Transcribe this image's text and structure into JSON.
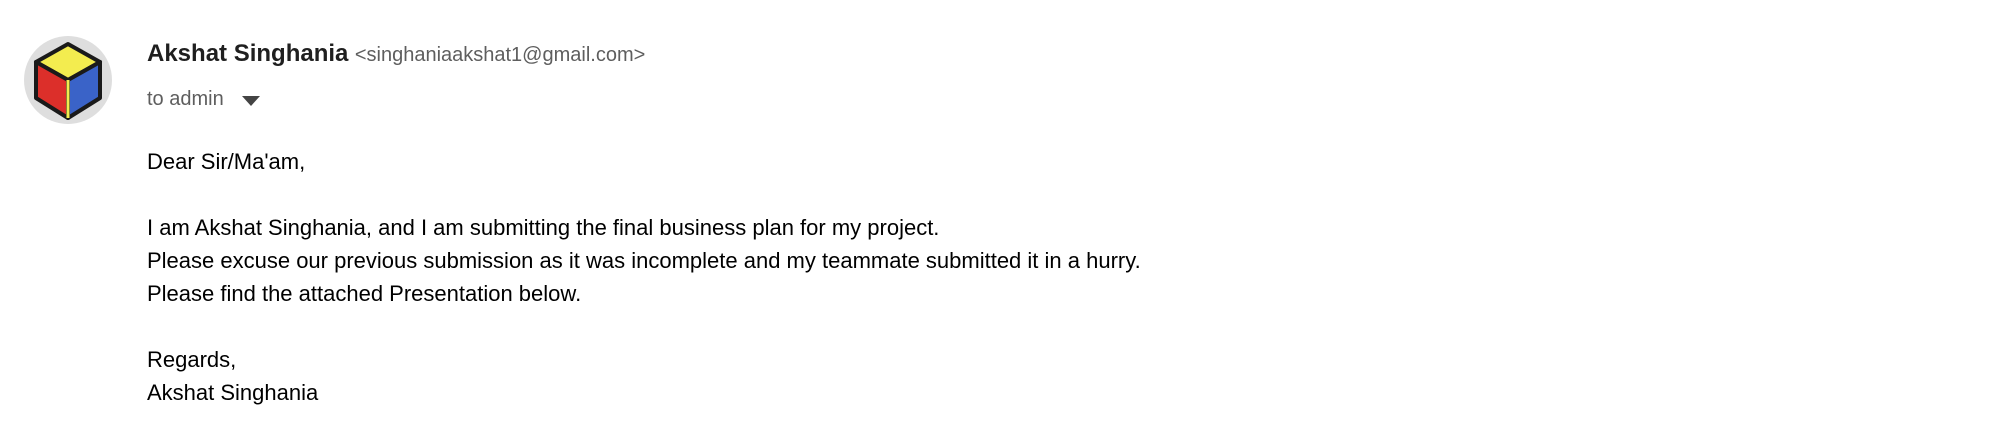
{
  "sender": {
    "name": "Akshat Singhania",
    "email": "<singhaniaakshat1@gmail.com>",
    "avatar_colors": {
      "top": "#f3ec4f",
      "left": "#dc2f2a",
      "right": "#3a63c8",
      "outline": "#1a1a1a",
      "background": "#dedede"
    }
  },
  "recipient": {
    "label": "to admin",
    "dropdown_icon": "chevron-down-icon"
  },
  "message": {
    "greeting": "Dear Sir/Ma'am,",
    "line1": "I am Akshat Singhania, and I am submitting the final business plan for my project.",
    "line2": "Please excuse our previous submission as it was incomplete and my teammate submitted it in a hurry.",
    "line3": "Please find the attached Presentation below.",
    "closing": "Regards,",
    "signature": "Akshat Singhania"
  }
}
